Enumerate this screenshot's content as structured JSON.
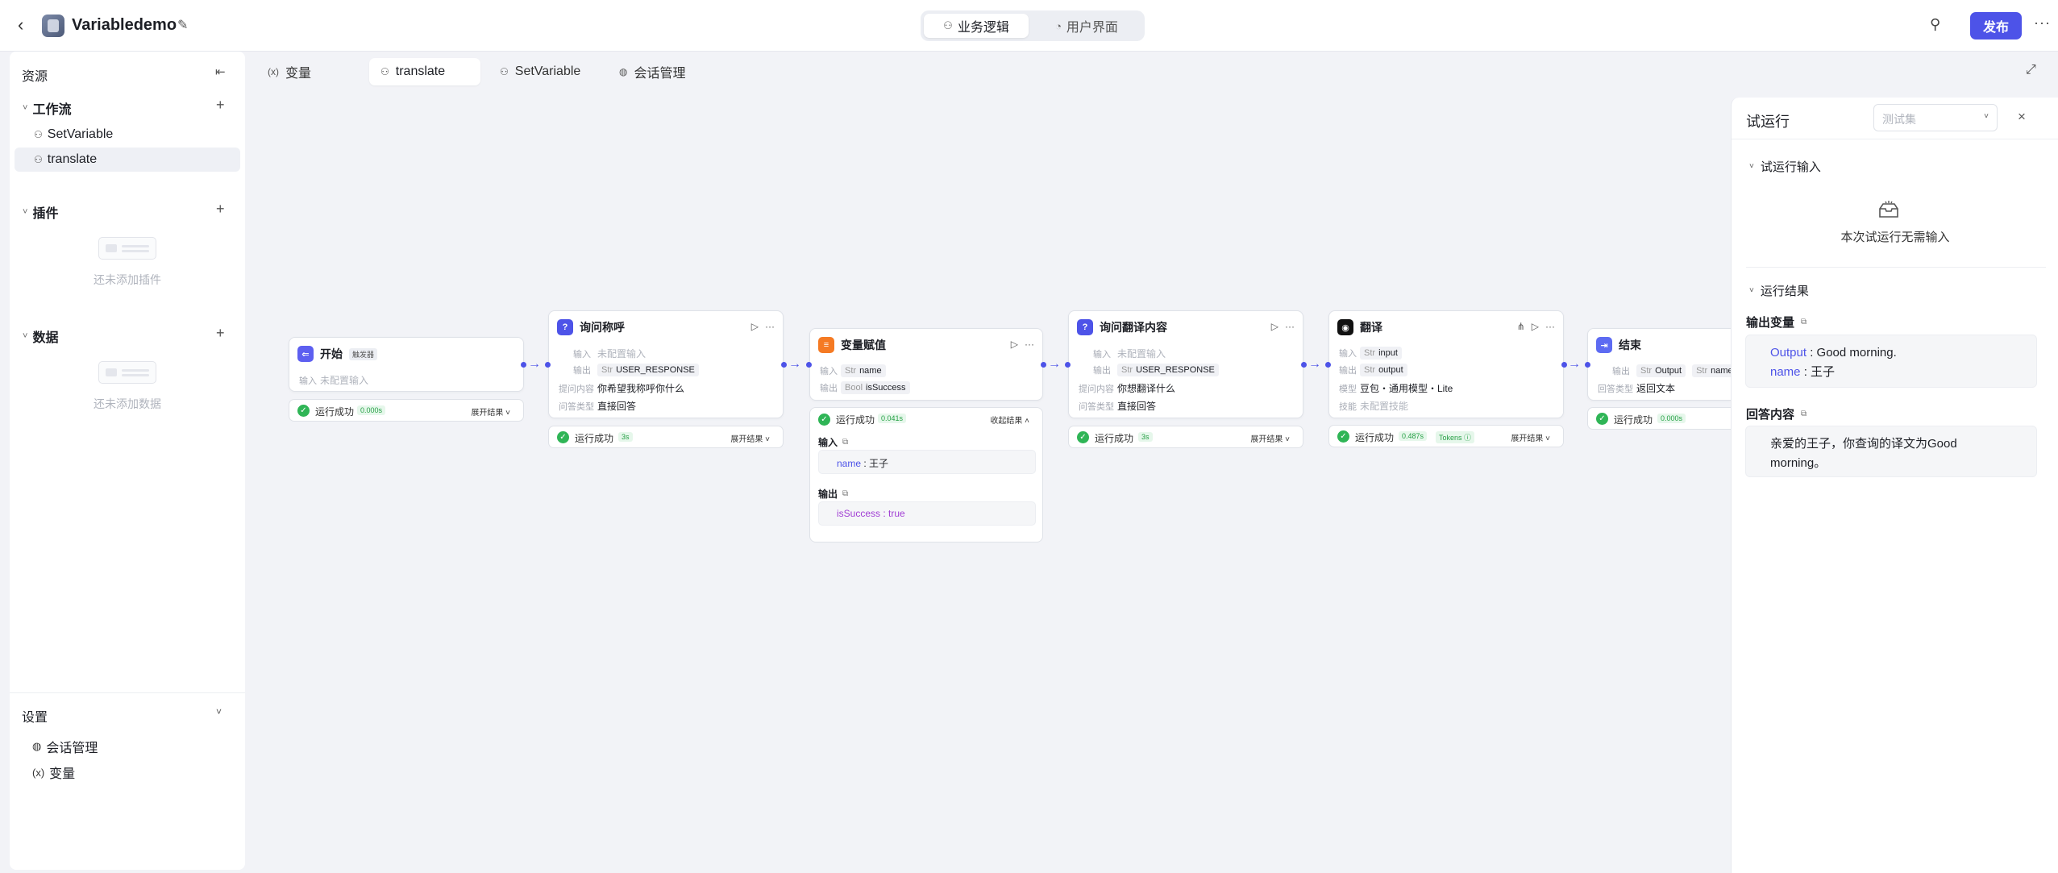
{
  "header": {
    "app_title": "Variabledemo",
    "mode_tabs": [
      "业务逻辑",
      "用户界面"
    ],
    "publish_label": "发布"
  },
  "sidebar": {
    "title": "资源",
    "workflow_section": "工作流",
    "workflows": [
      "SetVariable",
      "translate"
    ],
    "plugin_section": "插件",
    "plugin_empty": "还未添加插件",
    "data_section": "数据",
    "data_empty": "还未添加数据",
    "settings_title": "设置",
    "settings_items": [
      "会话管理",
      "变量"
    ]
  },
  "tabs": [
    "变量",
    "translate",
    "SetVariable",
    "会话管理"
  ],
  "nodes": {
    "start": {
      "title": "开始",
      "trigger_tag": "触发器",
      "input_label": "输入",
      "input_value": "未配置输入",
      "status": "运行成功",
      "time": "0.000s",
      "expand": "展开结果"
    },
    "ask_name": {
      "title": "询问称呼",
      "input_label": "输入",
      "input_value": "未配置输入",
      "output_label": "输出",
      "output_type": "Str",
      "output_value": "USER_RESPONSE",
      "question_label": "提问内容",
      "question_value": "你希望我称呼你什么",
      "qtype_label": "问答类型",
      "qtype_value": "直接回答",
      "status": "运行成功",
      "time": "3s",
      "expand": "展开结果"
    },
    "assign": {
      "title": "变量赋值",
      "input_label": "输入",
      "input_type": "Str",
      "input_value": "name",
      "output_label": "输出",
      "output_type": "Bool",
      "output_value": "isSuccess",
      "status": "运行成功",
      "time": "0.041s",
      "collapse": "收起结果",
      "result_input_title": "输入",
      "result_input_key": "name",
      "result_input_value": "王子",
      "result_output_title": "输出",
      "result_output_key": "isSuccess",
      "result_output_value": "true"
    },
    "ask_translate": {
      "title": "询问翻译内容",
      "input_label": "输入",
      "input_value": "未配置输入",
      "output_label": "输出",
      "output_type": "Str",
      "output_value": "USER_RESPONSE",
      "question_label": "提问内容",
      "question_value": "你想翻译什么",
      "qtype_label": "问答类型",
      "qtype_value": "直接回答",
      "status": "运行成功",
      "time": "3s",
      "expand": "展开结果"
    },
    "translate": {
      "title": "翻译",
      "input_label": "输入",
      "input_type": "Str",
      "input_value": "input",
      "output_label": "输出",
      "output_type": "Str",
      "output_value": "output",
      "model_label": "模型",
      "model_value": "豆包・通用模型・Lite",
      "skill_label": "技能",
      "skill_value": "未配置技能",
      "status": "运行成功",
      "time": "0.487s",
      "tokens": "Tokens",
      "expand": "展开结果"
    },
    "end": {
      "title": "结束",
      "output_label": "输出",
      "output_type": "Str",
      "output_value_1": "Output",
      "output_value_2": "name",
      "answer_label": "回答类型",
      "answer_value": "返回文本",
      "status": "运行成功",
      "time": "0.000s"
    }
  },
  "run_panel": {
    "title": "试运行",
    "testset_placeholder": "测试集",
    "input_section": "试运行输入",
    "no_input_text": "本次试运行无需输入",
    "result_section": "运行结果",
    "output_vars_label": "输出变量",
    "output_key_1": "Output",
    "output_value_1": "Good morning.",
    "output_key_2": "name",
    "output_value_2": "王子",
    "answer_label": "回答内容",
    "answer_text": "亲爱的王子，你查询的译文为Good morning。"
  },
  "colors": {
    "accent": "#4d53e8",
    "success": "#2fb556"
  },
  "icons": [
    "back-icon",
    "edit-icon",
    "collab-icon",
    "more-icon",
    "workflow-icon",
    "plus-icon",
    "close-icon",
    "copy-icon"
  ]
}
